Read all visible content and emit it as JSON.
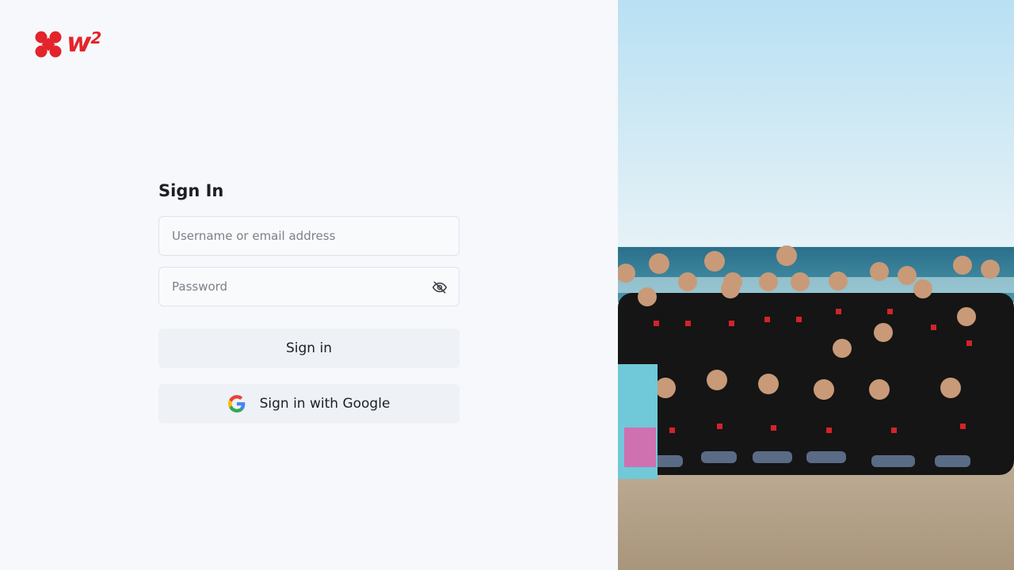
{
  "logo": {
    "text": "w",
    "superscript": "2",
    "brand_color": "#e3242b"
  },
  "sign_in": {
    "title": "Sign In",
    "username_placeholder": "Username or email address",
    "password_placeholder": "Password",
    "sign_in_label": "Sign in",
    "google_label": "Sign in with Google"
  },
  "icons": {
    "password_toggle": "eye-off-icon",
    "google": "google-icon"
  },
  "photo": {
    "subject": "team-group-photo-beach"
  }
}
